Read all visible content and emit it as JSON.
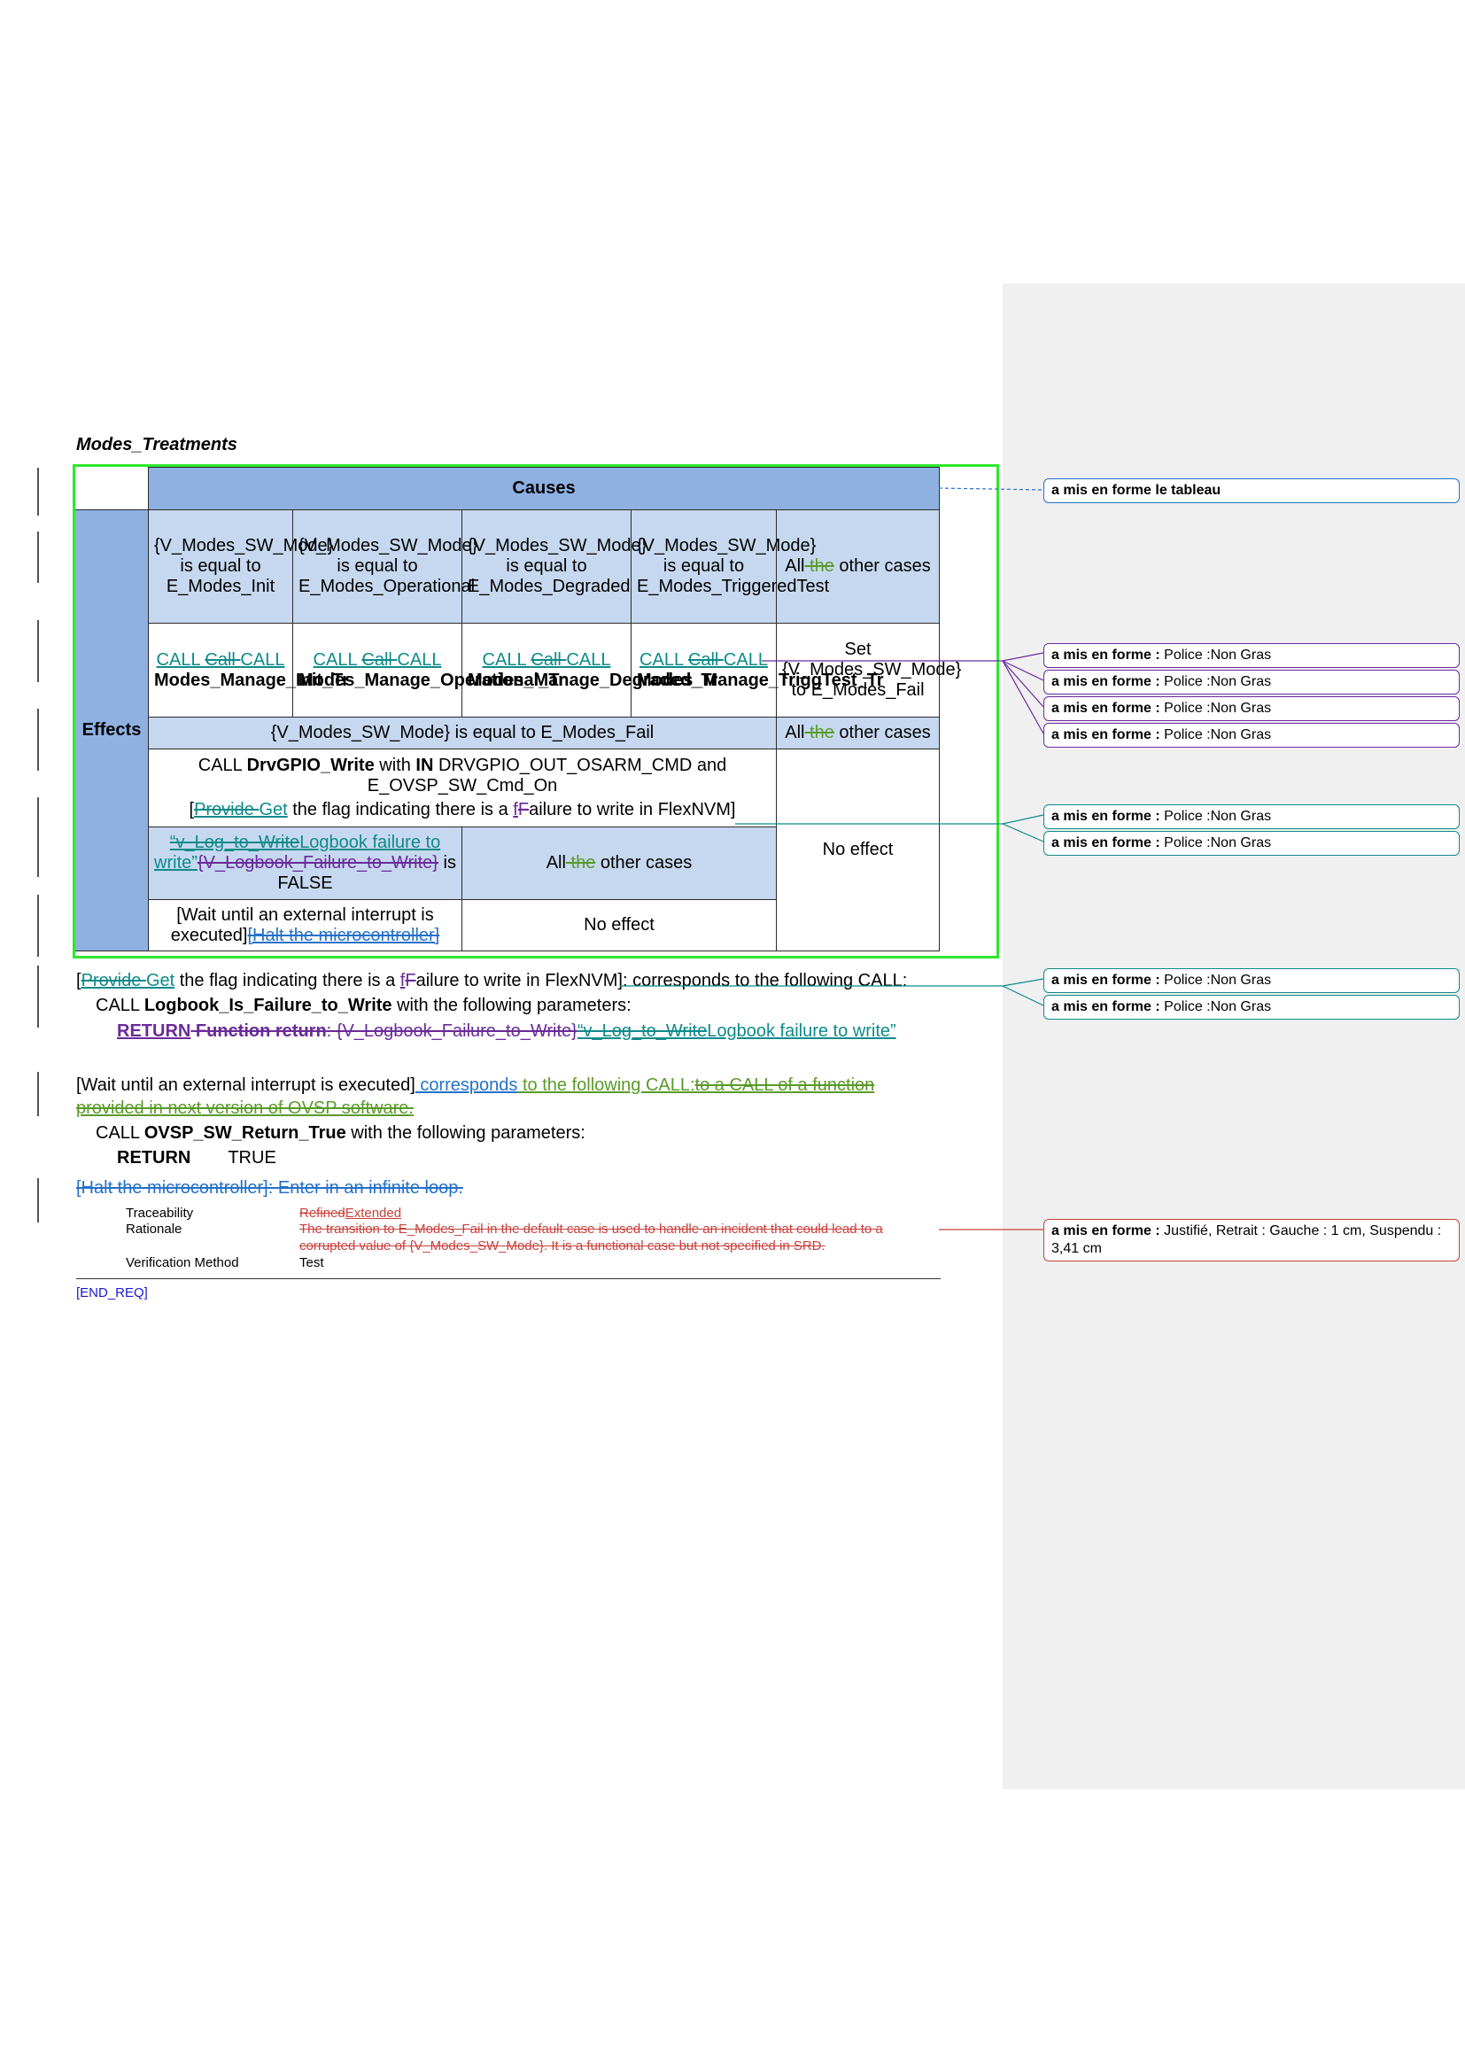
{
  "section_title": "Modes_Treatments",
  "table": {
    "causes_header": "Causes",
    "effects_header": "Effects",
    "conditions": [
      "{V_Modes_SW_Mode} is equal to E_Modes_Init",
      "{V_Modes_SW_Mode} is equal to E_Modes_Operational",
      "{V_Modes_SW_Mode} is equal to E_Modes_Degraded",
      "{V_Modes_SW_Mode} is equal to E_Modes_TriggeredTest"
    ],
    "all_other_1": {
      "a": "All",
      "del": " the",
      "b": " other cases"
    },
    "call_cells": [
      {
        "ins": "CALL ",
        "del": "Call ",
        "ins2": "CALL",
        "func": "Modes_Manage_Init_Tr"
      },
      {
        "ins": "CALL ",
        "del": "Call ",
        "ins2": "CALL",
        "func": "Modes_Manage_Operational_Tr"
      },
      {
        "ins": "CALL ",
        "del": "Call ",
        "ins2": "CALL",
        "func": "Modes_Manage_Degraded_Tr"
      },
      {
        "ins": "CALL ",
        "del": "Call ",
        "ins2": "CALL",
        "func": "Modes_Manage_TriggTest_Tr"
      }
    ],
    "set_fail": "Set {V_Modes_SW_Mode} to E_Modes_Fail",
    "fail_condition": "{V_Modes_SW_Mode} is equal to E_Modes_Fail",
    "all_other_2": {
      "a": "All",
      "del": " the",
      "b": " other cases"
    },
    "drv_call": {
      "pre": "CALL ",
      "func": "DrvGPIO_Write",
      "mid": " with ",
      "kw": "IN",
      "post": " DRVGPIO_OUT_OSARM_CMD and E_OVSP_SW_Cmd_On"
    },
    "provide_line": {
      "bracket": "[",
      "del": "Provide ",
      "ins": "Get",
      "mid": " the flag indicating there is a ",
      "ins2": "f",
      "del2": "F",
      "end": "ailure to write in FlexNVM]"
    },
    "logbook_cond": {
      "del1": "“v_Log_to_Write",
      "ins1": "Logbook failure to write”",
      "del2": "{V_Logbook_Failure_to_Write}",
      "mid": " is FALSE"
    },
    "all_other_3": {
      "a": "All",
      "del": " the",
      "b": " other cases"
    },
    "no_effect": "No effect",
    "wait_cell": {
      "text": "[Wait until an external interrupt is executed]",
      "del": "[Halt the microcontroller]"
    },
    "no_effect_2": "No effect"
  },
  "body": {
    "para1": {
      "b": "[",
      "del": "Provide ",
      "ins": "Get",
      "mid": " the flag indicating there is a ",
      "ins2": "f",
      "del2": "F",
      "end": "ailure to write in FlexNVM]: corresponds to the following CALL:"
    },
    "call1": {
      "pre": "CALL ",
      "func": "Logbook_Is_Failure_to_Write",
      "post": " with the following parameters:"
    },
    "ret1": {
      "ins": "RETURN",
      "del": " Function return",
      "del2": ": {V_Logbook_Failure_to_Write}",
      "del3": "“v_Log_to_Write",
      "ins2": "Logbook failure to write”"
    },
    "para2": {
      "text": "[Wait until an external interrupt is executed]",
      "ins": " corresponds",
      "ins2": " to the following CALL:",
      "del": "to a CALL of a function provided in next version of OVSP software."
    },
    "call2": {
      "pre": "CALL ",
      "func": "OVSP_SW_Return_True",
      "post": " with the following parameters:"
    },
    "ret2": {
      "kw": "RETURN",
      "val": "TRUE"
    },
    "halt": {
      "del": "[Halt the microcontroller]: Enter in an infinite loop."
    },
    "attrs": [
      {
        "label": "Traceability",
        "del": "Refined",
        "ins": "Extended"
      },
      {
        "label": "Rationale",
        "del": "The transition to E_Modes_Fail in the default case is used to handle an incident that could lead to a corrupted value of {V_Modes_SW_Mode}. It is a functional case but not specified in SRD."
      },
      {
        "label": "Verification Method",
        "value": "Test"
      }
    ],
    "end_req": "[END_REQ]"
  },
  "comments": [
    {
      "bold": "a mis en forme le tableau",
      "text": ""
    },
    {
      "bold": "a mis en forme : ",
      "text": "Police :Non Gras"
    },
    {
      "bold": "a mis en forme : ",
      "text": "Police :Non Gras"
    },
    {
      "bold": "a mis en forme : ",
      "text": "Police :Non Gras"
    },
    {
      "bold": "a mis en forme : ",
      "text": "Police :Non Gras"
    },
    {
      "bold": "a mis en forme : ",
      "text": "Police :Non Gras"
    },
    {
      "bold": "a mis en forme : ",
      "text": "Police :Non Gras"
    },
    {
      "bold": "a mis en forme : ",
      "text": "Police :Non Gras"
    },
    {
      "bold": "a mis en forme : ",
      "text": "Police :Non Gras"
    },
    {
      "bold": "a mis en forme : ",
      "text": "Justifié, Retrait : Gauche :  1 cm, Suspendu : 3,41 cm"
    }
  ],
  "colors": {
    "insert_blue": "#2471c9",
    "insert_teal": "#0e8a8a",
    "delete_green": "#5a9a2a",
    "delete_purple": "#6a2a9a",
    "rationale_red": "#c8403c",
    "table_header": "#8eb1e2",
    "table_light": "#c6d8ef",
    "frame_green": "#2ee82e"
  }
}
